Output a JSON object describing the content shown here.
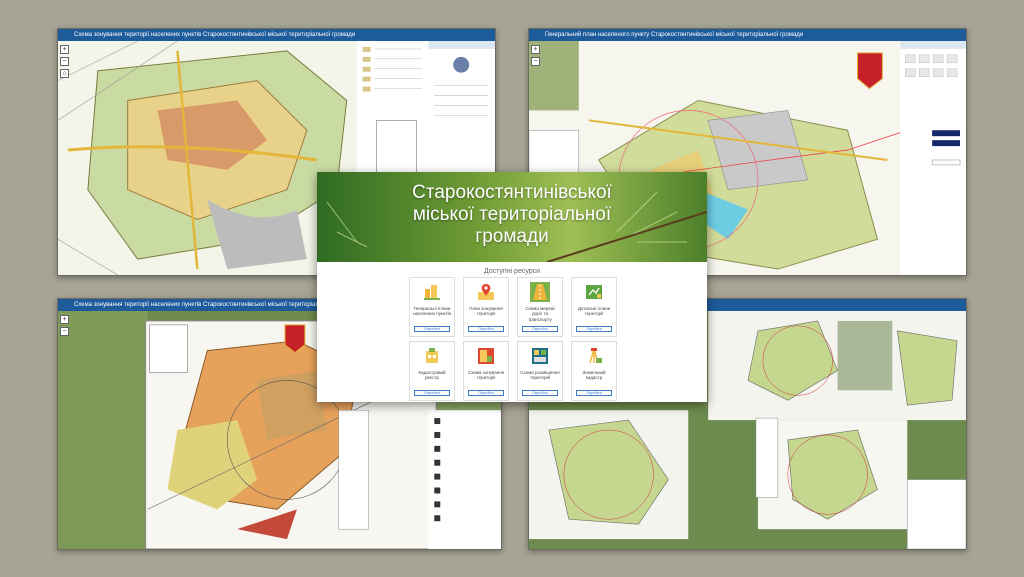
{
  "panels": {
    "top_left": {
      "title": "Схема зонування території населених пунктів Старокостянтинівської міської територіальної громади"
    },
    "top_right": {
      "title": "Генеральний план населеного пункту Старокостянтинівської міської територіальної громади"
    },
    "bottom_left": {
      "title": "Схема зонування території населених пунктів Старокостянтинівської міської територіальної громади"
    },
    "bottom_right": {
      "title": ""
    }
  },
  "hub": {
    "title_line1": "Старокостянтинівської",
    "title_line2": "міської територіальної",
    "title_line3": "громади",
    "resources_heading": "Доступні ресурси",
    "open_label": "Перейти",
    "tiles": [
      {
        "label": "Генеральні плани населених пунктів",
        "icon": "city-plan-icon"
      },
      {
        "label": "План зонування території",
        "icon": "map-pin-icon"
      },
      {
        "label": "Схема мережі доріг та транспорту",
        "icon": "road-icon"
      },
      {
        "label": "Детальні плани території",
        "icon": "detail-plan-icon"
      },
      {
        "label": "Кадастровий реєстр",
        "icon": "cadastre-icon"
      },
      {
        "label": "Схема зонування території",
        "icon": "zoning-icon"
      },
      {
        "label": "Схема розміщення територій",
        "icon": "layout-icon"
      },
      {
        "label": "Земельний кадастр",
        "icon": "survey-icon"
      }
    ]
  },
  "colors": {
    "background": "#a7a496",
    "titlebar": "#1e5b9a",
    "accent": "#3b7bc6"
  }
}
